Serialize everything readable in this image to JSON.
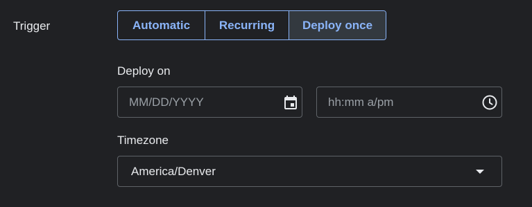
{
  "trigger": {
    "label": "Trigger",
    "options": [
      "Automatic",
      "Recurring",
      "Deploy once"
    ],
    "selected": "Deploy once"
  },
  "deploy_on": {
    "label": "Deploy on",
    "date_placeholder": "MM/DD/YYYY",
    "time_placeholder": "hh:mm a/pm",
    "date_icon": "calendar-icon",
    "time_icon": "clock-icon"
  },
  "timezone": {
    "label": "Timezone",
    "value": "America/Denver",
    "icon": "chevron-down-icon"
  },
  "colors": {
    "background": "#202124",
    "accent": "#8ab4f8",
    "selected_bg": "#33393f",
    "text": "#e8eaed",
    "placeholder": "#9aa0a6",
    "border": "#5f6368"
  }
}
